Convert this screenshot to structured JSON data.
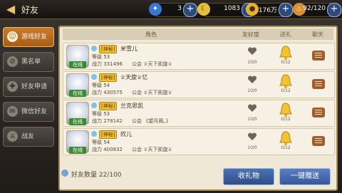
{
  "header": {
    "title": "好友",
    "resources": [
      {
        "icon": "crystal-icon",
        "value": "3"
      },
      {
        "icon": "moon-icon",
        "value": "1083"
      },
      {
        "icon": "coin-icon",
        "value": "176万"
      },
      {
        "icon": "stamina-icon",
        "value": "92/120"
      }
    ]
  },
  "sidebar": {
    "items": [
      {
        "label": "游戏好友",
        "active": true
      },
      {
        "label": "黑名单",
        "active": false
      },
      {
        "label": "好友申请",
        "active": false
      },
      {
        "label": "微信好友",
        "active": false
      },
      {
        "label": "战友",
        "active": false
      }
    ]
  },
  "table": {
    "headers": [
      "角色",
      "友好度",
      "送礼",
      "聊天"
    ],
    "rows": [
      {
        "vip": "[神秘]",
        "name": "米雪儿",
        "level": "等级 53",
        "power": "战力 331496",
        "guild": "公会 ♕天下凯旋♕",
        "online": "在线",
        "favor": "10/0",
        "gift": "0/12"
      },
      {
        "vip": "[神秘]",
        "name": "♕天旋♕亿",
        "level": "等级 54",
        "power": "战力 430575",
        "guild": "公会 ♕天下凯旋♕",
        "online": "在线",
        "favor": "10/0",
        "gift": "0/12"
      },
      {
        "vip": "[神秘]",
        "name": "兰克思凯",
        "level": "等级 53",
        "power": "战力 278142",
        "guild": "公会 《望月阁。》",
        "online": "在线",
        "favor": "10/0",
        "gift": "0/12"
      },
      {
        "vip": "[神秘]",
        "name": "欣儿",
        "level": "等级 54",
        "power": "战力 400832",
        "guild": "公会 ♕天下凯旋♕",
        "online": "在线",
        "favor": "10/0",
        "gift": "0/12"
      }
    ]
  },
  "footer": {
    "count": "好友数量 22/100",
    "receive_label": "收礼物",
    "send_label": "一键赠送"
  },
  "colors": {
    "accent": "#c97b2c",
    "online": "#3c8a32",
    "button": "#3c5f9d"
  }
}
